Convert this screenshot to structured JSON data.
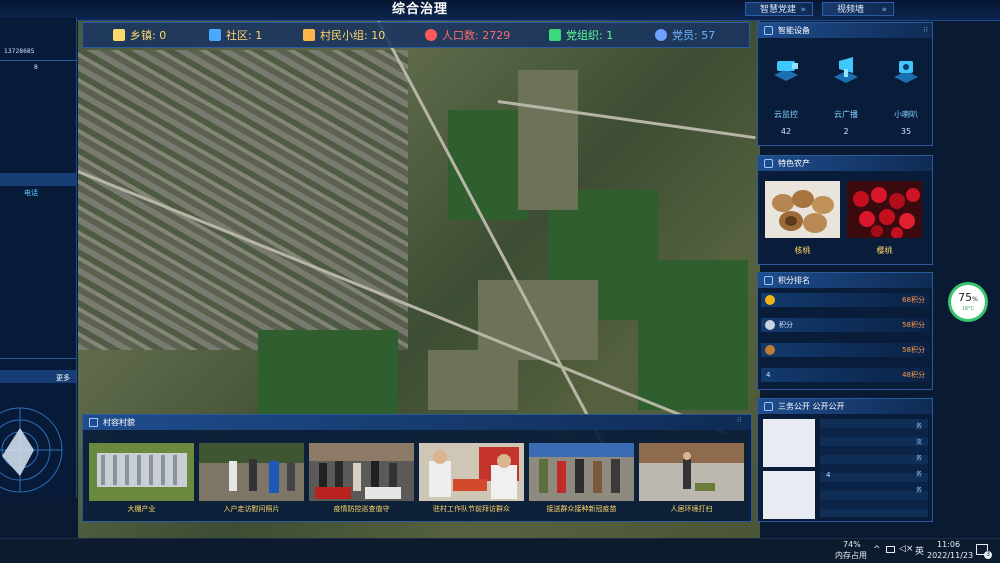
{
  "title": "综合治理",
  "top_buttons": [
    {
      "label": "智慧党建"
    },
    {
      "label": "视频墙"
    }
  ],
  "stats": [
    {
      "label": "乡镇: 0",
      "color": "#ffd86b"
    },
    {
      "label": "社区: 1",
      "color": "#ffd86b"
    },
    {
      "label": "村民小组: 10",
      "color": "#ffd86b"
    },
    {
      "label": "人口数: 2729",
      "color": "#ff6b6b"
    },
    {
      "label": "党组织: 1",
      "color": "#5bff9b"
    },
    {
      "label": "党员: 57",
      "color": "#6fb3ff"
    }
  ],
  "left_panel": {
    "phone": "13728685",
    "sub": "8",
    "phone_label": "电话",
    "more": "更多"
  },
  "devices": {
    "title": "智能设备",
    "items": [
      {
        "label": "云监控",
        "count": "42"
      },
      {
        "label": "云广播",
        "count": "2"
      },
      {
        "label": "小喇叭",
        "count": "35"
      }
    ]
  },
  "products": {
    "title": "特色农产",
    "items": [
      {
        "label": "核桃"
      },
      {
        "label": "樱桃"
      }
    ]
  },
  "ranking": {
    "title": "积分排名",
    "rows": [
      {
        "name": "",
        "points": "68积分",
        "medal_color": "#f3b418"
      },
      {
        "name": "积分",
        "points": "58积分",
        "medal_color": "#c9d2dd"
      },
      {
        "name": "",
        "points": "58积分",
        "medal_color": "#c27a35"
      },
      {
        "name": "4",
        "points": "48积分",
        "medal_color": ""
      }
    ]
  },
  "public_affairs": {
    "title": "三务公开 公开公开",
    "marks": [
      "务",
      "流",
      "务",
      "务",
      "务"
    ],
    "num": "4"
  },
  "village": {
    "title": "村容村貌",
    "photos": [
      {
        "caption": "大棚产业"
      },
      {
        "caption": "入户走访慰问照片"
      },
      {
        "caption": "疫情防控巡查值守"
      },
      {
        "caption": "驻村工作队节前拜访群众"
      },
      {
        "caption": "接送群众接种新冠疫苗"
      },
      {
        "caption": "人居环境打扫"
      }
    ]
  },
  "memory_widget": {
    "percent": "75",
    "unit": "%",
    "temp": "16°C"
  },
  "taskbar": {
    "mem_pct": "74%",
    "mem_label": "内存占用",
    "ime": "英",
    "time": "11:06",
    "date": "2022/11/23",
    "notif_count": "3"
  }
}
